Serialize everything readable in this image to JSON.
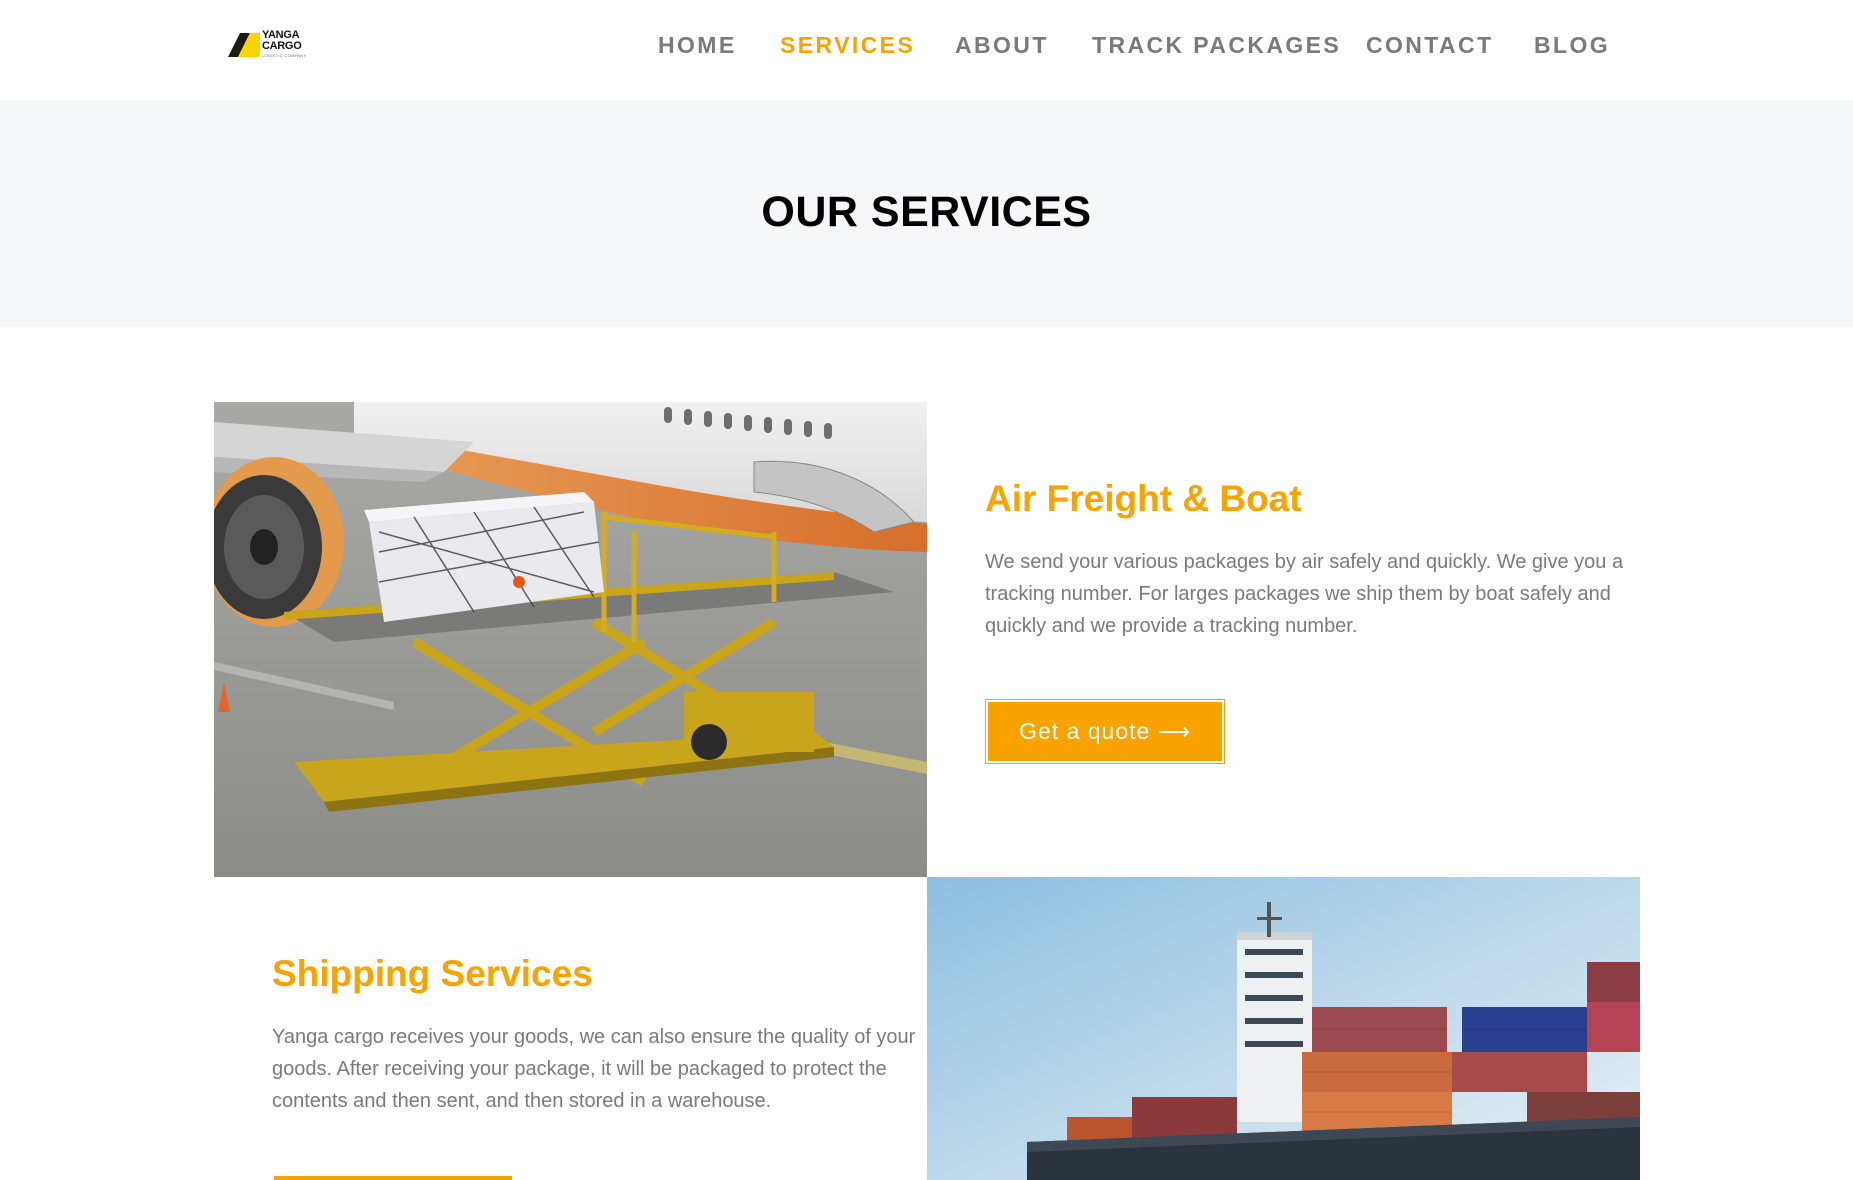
{
  "brand": {
    "name": "YANGA CARGO",
    "tagline": "LOGISTIC COMPANY"
  },
  "nav": {
    "items": [
      {
        "label": "HOME"
      },
      {
        "label": "SERVICES"
      },
      {
        "label": "ABOUT"
      },
      {
        "label": "TRACK PACKAGES"
      },
      {
        "label": "CONTACT"
      },
      {
        "label": "BLOG"
      }
    ],
    "active": "SERVICES"
  },
  "page": {
    "title": "OUR SERVICES"
  },
  "services": [
    {
      "title": "Air Freight & Boat",
      "description": "We send your various packages by air safely and quickly. We give you a tracking number. For larges packages we ship them by boat safely and quickly and we provide a tracking number.",
      "button": "Get a quote",
      "image": "cargo-loader-airplane"
    },
    {
      "title": "Shipping Services",
      "description": "Yanga cargo receives your goods, we can also ensure the quality of your goods. After receiving your package, it will be  packaged to protect the contents and then sent, and then stored in a warehouse.",
      "image": "container-ship"
    }
  ],
  "colors": {
    "accent": "#f9a300",
    "nav_text": "#7a7a7a",
    "title_band": "#f6f7f9",
    "heading": "#000000",
    "body_text": "#7a7a7a"
  },
  "icons": {
    "button_arrow": "long-arrow-right-icon"
  }
}
